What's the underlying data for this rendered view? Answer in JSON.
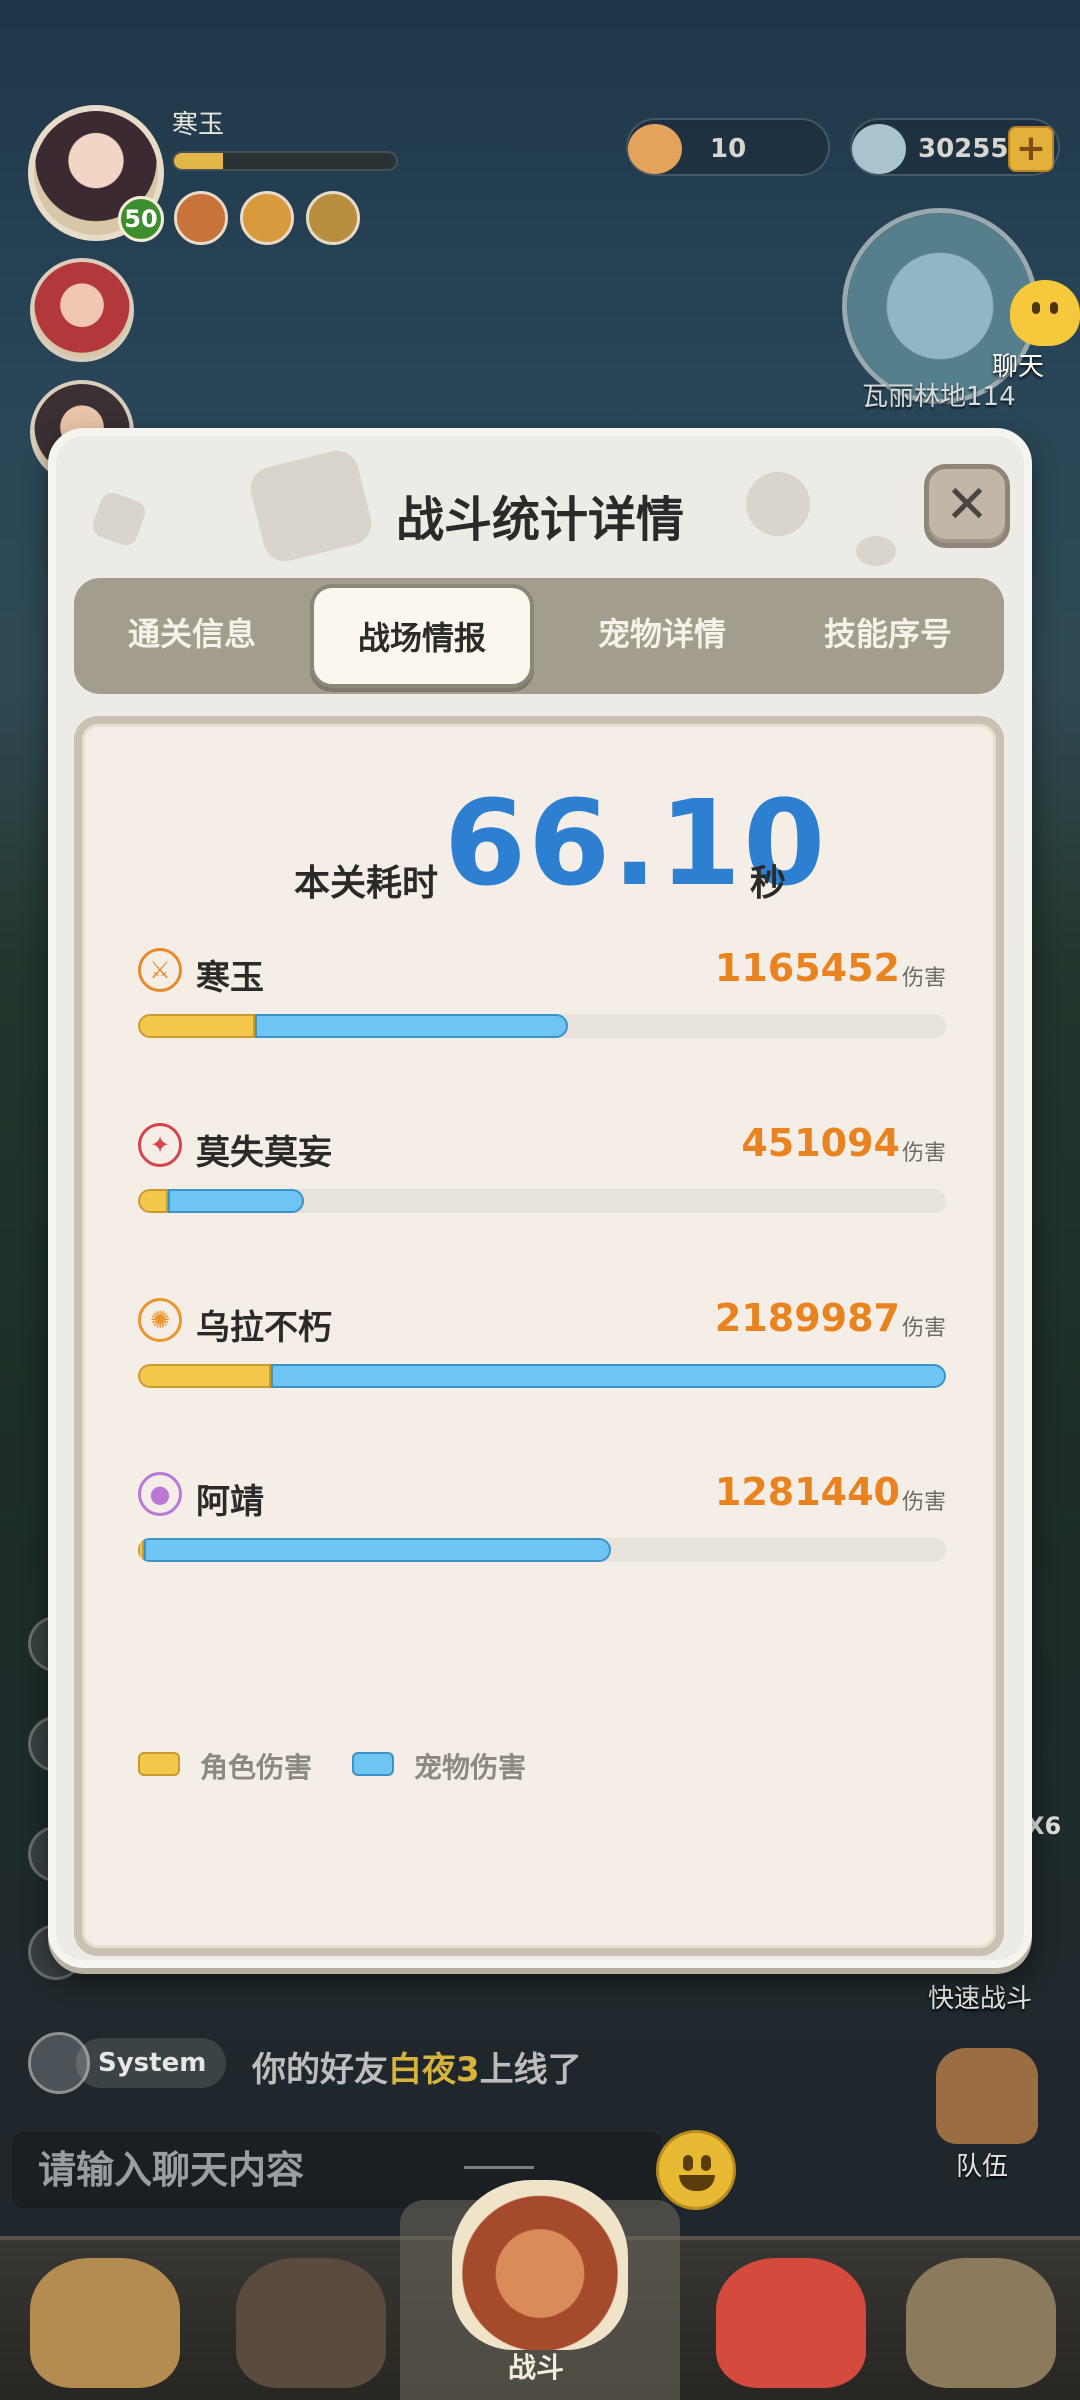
{
  "hud": {
    "player_name": "寒玉",
    "player_level": "50",
    "hp_fraction": 0.22,
    "shell_count": "10",
    "gem_count": "30255",
    "plus_label": "+",
    "map_label": "瓦丽林地114",
    "chat_button_label": "聊天",
    "quick_battle_label": "快速战斗",
    "team_label": "队伍",
    "x6_label": "X6"
  },
  "chat": {
    "system_tag": "System",
    "msg_prefix": "你的好友",
    "msg_friend": "白夜3",
    "msg_suffix": "上线了",
    "input_placeholder": "请输入聊天内容"
  },
  "bottom_nav": {
    "center_label": "战斗"
  },
  "modal": {
    "title": "战斗统计详情",
    "close_label": "✕",
    "tabs": [
      {
        "label": "通关信息",
        "active": false
      },
      {
        "label": "战场情报",
        "active": true
      },
      {
        "label": "宠物详情",
        "active": false
      },
      {
        "label": "技能序号",
        "active": false
      }
    ],
    "time_label": "本关耗时",
    "time_value": "66.10",
    "time_unit": "秒",
    "damage_unit": "伤害",
    "players": [
      {
        "name": "寒玉",
        "damage": "1165452",
        "icon": "sword-crest-icon",
        "icon_color": "#e88a2a",
        "char_fraction": 0.145,
        "pet_fraction": 0.387
      },
      {
        "name": "莫失莫妄",
        "damage": "451094",
        "icon": "wolf-crest-icon",
        "icon_color": "#d6434a",
        "char_fraction": 0.037,
        "pet_fraction": 0.169
      },
      {
        "name": "乌拉不朽",
        "damage": "2189987",
        "icon": "flame-crest-icon",
        "icon_color": "#ea9530",
        "char_fraction": 0.165,
        "pet_fraction": 0.835
      },
      {
        "name": "阿靖",
        "damage": "1281440",
        "icon": "orb-crest-icon",
        "icon_color": "#b978d8",
        "char_fraction": 0.008,
        "pet_fraction": 0.577
      }
    ],
    "legend": {
      "character_label": "角色伤害",
      "pet_label": "宠物伤害",
      "character_color": "#f4c84d",
      "pet_color": "#6ec4f2"
    }
  }
}
